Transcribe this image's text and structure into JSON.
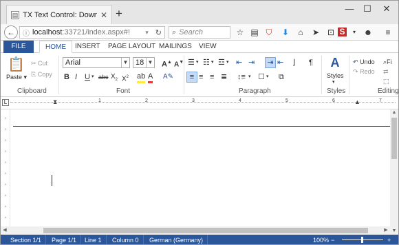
{
  "browser": {
    "tab_title": "TX Text Control: Download do...",
    "tab_close": "✕",
    "new_tab": "+",
    "url_host": "localhost",
    "url_path": ":33721/index.aspx#!",
    "search_placeholder": "Search"
  },
  "ribbon": {
    "tabs": [
      "FILE",
      "HOME",
      "INSERT",
      "PAGE LAYOUT",
      "MAILINGS",
      "VIEW"
    ],
    "clipboard": {
      "paste": "Paste",
      "cut": "Cut",
      "copy": "Copy",
      "label": "Clipboard"
    },
    "font": {
      "family": "Arial",
      "size": "18",
      "label": "Font"
    },
    "paragraph": {
      "label": "Paragraph"
    },
    "styles": {
      "button": "Styles",
      "label": "Styles"
    },
    "editing": {
      "undo": "Undo",
      "redo": "Redo",
      "find": "Fi",
      "label": "Editing"
    }
  },
  "ruler": {
    "numbers": [
      "1",
      "2",
      "3",
      "4",
      "5",
      "6",
      "7",
      "8"
    ]
  },
  "status": {
    "section": "Section 1/1",
    "page": "Page 1/1",
    "line": "Line 1",
    "column": "Column 0",
    "language": "German (Germany)",
    "zoom": "100%",
    "zoom_minus": "−",
    "zoom_plus": "+"
  },
  "colors": {
    "accent": "#2b579a"
  }
}
